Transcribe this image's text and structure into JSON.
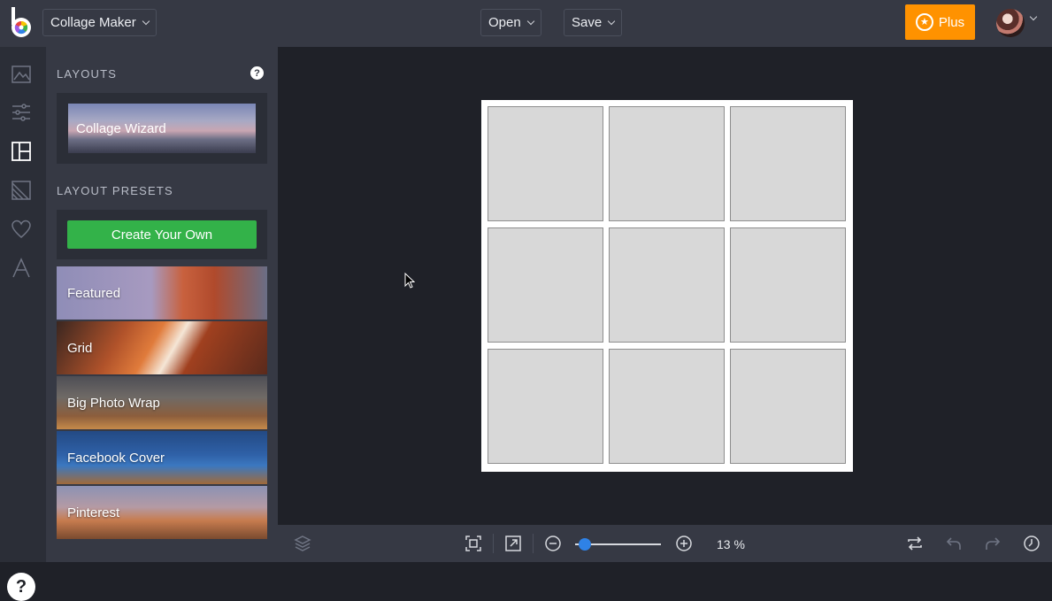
{
  "topbar": {
    "app_menu": "Collage Maker",
    "open_label": "Open",
    "save_label": "Save",
    "plus_label": "Plus"
  },
  "sidebar_icons": [
    "image-icon",
    "sliders-icon",
    "layout-icon",
    "texture-icon",
    "heart-icon",
    "text-icon"
  ],
  "panel": {
    "layouts_title": "LAYOUTS",
    "wizard_label": "Collage Wizard",
    "presets_title": "LAYOUT PRESETS",
    "create_label": "Create Your Own",
    "presets": [
      {
        "label": "Featured"
      },
      {
        "label": "Grid"
      },
      {
        "label": "Big Photo Wrap"
      },
      {
        "label": "Facebook Cover"
      },
      {
        "label": "Pinterest"
      }
    ]
  },
  "help_label": "?",
  "canvas": {
    "grid_rows": 3,
    "grid_cols": 3
  },
  "bottombar": {
    "zoom_label": "13 %",
    "zoom_fraction": 0.05
  },
  "colors": {
    "accent_orange": "#ff9200",
    "create_green": "#33b249",
    "slider_blue": "#2f82e6"
  }
}
